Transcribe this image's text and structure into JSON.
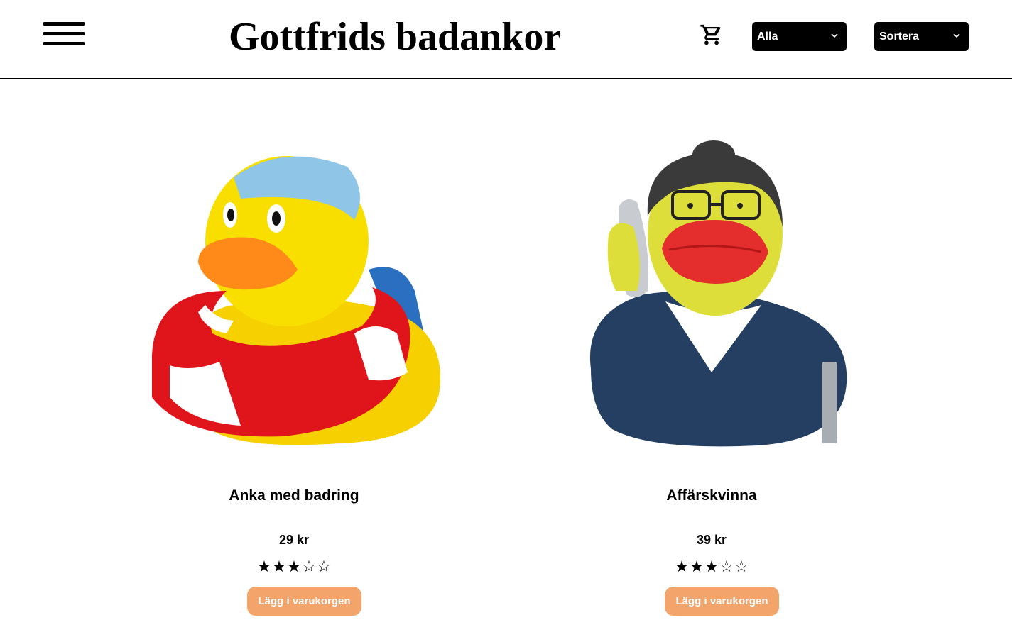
{
  "header": {
    "title": "Gottfrids badankor",
    "menu_icon": "hamburger-menu-icon",
    "cart_icon": "shopping-cart-icon",
    "filter_select": {
      "value": "Alla"
    },
    "sort_select": {
      "value": "Sortera"
    }
  },
  "products": [
    {
      "name": "Anka med badring",
      "price": "29 kr",
      "rating": 3,
      "rating_max": 5,
      "button_label": "Lägg i varukorgen",
      "image_icon": "rubber-duck-with-swim-ring-image"
    },
    {
      "name": "Affärskvinna",
      "price": "39 kr",
      "rating": 3,
      "rating_max": 5,
      "button_label": "Lägg i varukorgen",
      "image_icon": "businesswoman-rubber-duck-image"
    }
  ],
  "colors": {
    "button_bg": "#f2a46a",
    "select_bg": "#000000"
  }
}
